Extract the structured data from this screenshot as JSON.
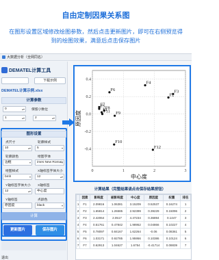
{
  "banner": {
    "title": "自由定制因果关系图",
    "description": "在图形设置区域修改绘图参数，然后点击更新图片，即可在右侧预览得到的绘图效果，满意后点击保存图片"
  },
  "window": {
    "title": "大数据分析（全网同名）"
  },
  "app": {
    "title": "DEMATEL计算工具",
    "prev_button": "",
    "next_button": "下载示例",
    "file_name": "DEMATEL计算示例.xlsx"
  },
  "calc_params": {
    "header": "计算参数",
    "fields": [
      {
        "label": "",
        "value": "0",
        "unit": "保留小数位"
      },
      {
        "label": "",
        "value": "1",
        "unit": "2"
      }
    ]
  },
  "graph_settings": {
    "header": "图形设置",
    "fields": [
      {
        "label": "点尺寸",
        "value": "10"
      },
      {
        "label": "轮廓样式",
        "value": "5"
      },
      {
        "label": "轮廓颜色",
        "value": "边框"
      },
      {
        "label": "绘图字体",
        "value": "imes New Roman"
      },
      {
        "label": "绘图样式",
        "value": "bmh"
      },
      {
        "label": "X轴标签字体大小",
        "value": "12"
      },
      {
        "label": "Y轴标签字体大小",
        "value": "12"
      },
      {
        "label": "X轴标签",
        "value": "中心度"
      },
      {
        "label": "Y轴标签",
        "value": "原因度"
      },
      {
        "label": "点颜色",
        "value": "black"
      }
    ]
  },
  "buttons": {
    "calculate": "计算",
    "update_plot": "更新图片",
    "save_plot": "保存图片",
    "exit": "退出"
  },
  "chart_data": {
    "type": "scatter",
    "xlabel": "中心度",
    "ylabel": "原因度",
    "xlim": [
      0,
      3
    ],
    "ylim": [
      -0.6,
      0.5
    ],
    "xticks": [
      "0",
      "1",
      "2",
      "3"
    ],
    "yticks": [
      "0.4",
      "0.2",
      "0.0",
      "-0.2",
      "-0.4"
    ],
    "grid": true,
    "points": [
      {
        "label": "F1",
        "x": 0.3,
        "y": 0.02
      },
      {
        "label": "F2",
        "x": 2.45,
        "y": 0.19
      },
      {
        "label": "F3",
        "x": 2.6,
        "y": 0.23
      },
      {
        "label": "F4",
        "x": 1.7,
        "y": 0.33
      },
      {
        "label": "F5",
        "x": 0.22,
        "y": 0.06
      },
      {
        "label": "F6",
        "x": 0.55,
        "y": 0.25
      },
      {
        "label": "F7",
        "x": 0.22,
        "y": 0.08
      },
      {
        "label": "F8",
        "x": 0.38,
        "y": 0.04
      },
      {
        "label": "F9",
        "x": 0.72,
        "y": -0.02
      },
      {
        "label": "F10",
        "x": 0.7,
        "y": -0.35
      },
      {
        "label": "F11",
        "x": 0.32,
        "y": 0.0
      },
      {
        "label": "F12",
        "x": 1.95,
        "y": -0.41
      }
    ]
  },
  "results": {
    "title": "计算结果（完整结果请点击保存结果按钮）",
    "columns": [
      "",
      "因素",
      "影响度",
      "被影响度",
      "中心度",
      "原因度",
      "权重",
      "排名"
    ],
    "rows": [
      [
        "1",
        "F1",
        "2.09816",
        "1.06381",
        "3.15209",
        "0.52537",
        "0.16274",
        "1"
      ],
      [
        "2",
        "F2",
        "1.65814",
        "1.26585",
        "2.92399",
        "0.39229",
        "0.15096",
        "2"
      ],
      [
        "3",
        "F3",
        "2.42064",
        "2.0517",
        "4.47234",
        "0.36894",
        "0.1447",
        "3"
      ],
      [
        "4",
        "F4",
        "0.51761",
        "0.47842",
        "1.98952",
        "0.04866",
        "0.10227",
        "4"
      ],
      [
        "5",
        "F5",
        "0.78097",
        "0.84167",
        "1.62264",
        "-0.06",
        "0.08361",
        "5"
      ],
      [
        "6",
        "F6",
        "1.03171",
        "0.92785",
        "1.95956",
        "0.10386",
        "0.10124",
        "6"
      ],
      [
        "7",
        "F7",
        "0.62913",
        "1.04627",
        "1.6754",
        "-0.41714",
        "0.08839",
        "7"
      ]
    ]
  }
}
